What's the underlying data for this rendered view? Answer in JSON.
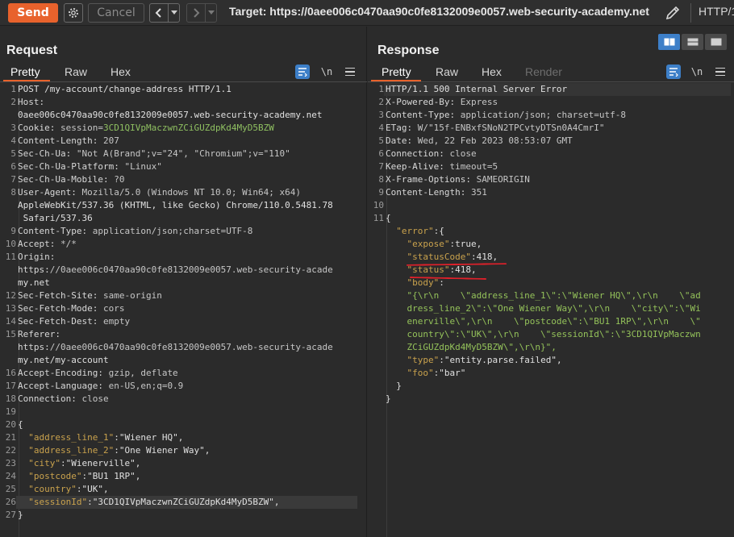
{
  "toolbar": {
    "send_label": "Send",
    "cancel_label": "Cancel",
    "target": "Target: https://0aee006c0470aa90c0fe8132009e0057.web-security-academy.net",
    "http_version": "HTTP/1"
  },
  "request": {
    "title": "Request",
    "tabs": [
      "Pretty",
      "Raw",
      "Hex"
    ],
    "active_tab": "Pretty",
    "lines": [
      {
        "n": "1",
        "text": "POST /my-account/change-address HTTP/1.1"
      },
      {
        "n": "2",
        "text": "Host:"
      },
      {
        "n": "",
        "text": "0aee006c0470aa90c0fe8132009e0057.web-security-academy.net"
      },
      {
        "n": "3",
        "text": "Cookie: session=3CD1QIVpMaczwnZCiGUZdpKd4MyD5BZW"
      },
      {
        "n": "4",
        "text": "Content-Length: 207"
      },
      {
        "n": "5",
        "text": "Sec-Ch-Ua: \"Not A(Brand\";v=\"24\", \"Chromium\";v=\"110\""
      },
      {
        "n": "6",
        "text": "Sec-Ch-Ua-Platform: \"Linux\""
      },
      {
        "n": "7",
        "text": "Sec-Ch-Ua-Mobile: ?0"
      },
      {
        "n": "8",
        "text": "User-Agent: Mozilla/5.0 (Windows NT 10.0; Win64; x64)"
      },
      {
        "n": "",
        "text": "AppleWebKit/537.36 (KHTML, like Gecko) Chrome/110.0.5481.78"
      },
      {
        "n": "",
        "text": " Safari/537.36"
      },
      {
        "n": "9",
        "text": "Content-Type: application/json;charset=UTF-8"
      },
      {
        "n": "10",
        "text": "Accept: */*"
      },
      {
        "n": "11",
        "text": "Origin:"
      },
      {
        "n": "",
        "text": "https://0aee006c0470aa90c0fe8132009e0057.web-security-acade"
      },
      {
        "n": "",
        "text": "my.net"
      },
      {
        "n": "12",
        "text": "Sec-Fetch-Site: same-origin"
      },
      {
        "n": "13",
        "text": "Sec-Fetch-Mode: cors"
      },
      {
        "n": "14",
        "text": "Sec-Fetch-Dest: empty"
      },
      {
        "n": "15",
        "text": "Referer:"
      },
      {
        "n": "",
        "text": "https://0aee006c0470aa90c0fe8132009e0057.web-security-acade"
      },
      {
        "n": "",
        "text": "my.net/my-account"
      },
      {
        "n": "16",
        "text": "Accept-Encoding: gzip, deflate"
      },
      {
        "n": "17",
        "text": "Accept-Language: en-US,en;q=0.9"
      },
      {
        "n": "18",
        "text": "Connection: close"
      },
      {
        "n": "19",
        "text": ""
      },
      {
        "n": "20",
        "text": "{"
      },
      {
        "n": "21",
        "text": "  \"address_line_1\":\"Wiener HQ\","
      },
      {
        "n": "22",
        "text": "  \"address_line_2\":\"One Wiener Way\","
      },
      {
        "n": "23",
        "text": "  \"city\":\"Wienerville\","
      },
      {
        "n": "24",
        "text": "  \"postcode\":\"BU1 1RP\","
      },
      {
        "n": "25",
        "text": "  \"country\":\"UK\","
      },
      {
        "n": "26",
        "text": "  \"sessionId\":\"3CD1QIVpMaczwnZCiGUZdpKd4MyD5BZW\","
      },
      {
        "n": "27",
        "text": "}"
      }
    ]
  },
  "response": {
    "title": "Response",
    "tabs": [
      "Pretty",
      "Raw",
      "Hex",
      "Render"
    ],
    "active_tab": "Pretty",
    "lines": [
      {
        "n": "1",
        "text": "HTTP/1.1 500 Internal Server Error"
      },
      {
        "n": "2",
        "text": "X-Powered-By: Express"
      },
      {
        "n": "3",
        "text": "Content-Type: application/json; charset=utf-8"
      },
      {
        "n": "4",
        "text": "ETag: W/\"15f-ENBxfSNoN2TPCvtyDTSn0A4CmrI\""
      },
      {
        "n": "5",
        "text": "Date: Wed, 22 Feb 2023 08:53:07 GMT"
      },
      {
        "n": "6",
        "text": "Connection: close"
      },
      {
        "n": "7",
        "text": "Keep-Alive: timeout=5"
      },
      {
        "n": "8",
        "text": "X-Frame-Options: SAMEORIGIN"
      },
      {
        "n": "9",
        "text": "Content-Length: 351"
      },
      {
        "n": "10",
        "text": ""
      },
      {
        "n": "11",
        "text": "{"
      },
      {
        "n": "",
        "text": "  \"error\":{"
      },
      {
        "n": "",
        "text": "    \"expose\":true,"
      },
      {
        "n": "",
        "text": "    \"statusCode\":418,"
      },
      {
        "n": "",
        "text": "    \"status\":418,"
      },
      {
        "n": "",
        "text": "    \"body\":"
      },
      {
        "n": "",
        "text": "    \"{\\r\\n    \\\"address_line_1\\\":\\\"Wiener HQ\\\",\\r\\n    \\\"ad"
      },
      {
        "n": "",
        "text": "    dress_line_2\\\":\\\"One Wiener Way\\\",\\r\\n    \\\"city\\\":\\\"Wi"
      },
      {
        "n": "",
        "text": "    enerville\\\",\\r\\n    \\\"postcode\\\":\\\"BU1 1RP\\\",\\r\\n    \\\""
      },
      {
        "n": "",
        "text": "    country\\\":\\\"UK\\\",\\r\\n    \\\"sessionId\\\":\\\"3CD1QIVpMaczwn"
      },
      {
        "n": "",
        "text": "    ZCiGUZdpKd4MyD5BZW\\\",\\r\\n}\","
      },
      {
        "n": "",
        "text": "    \"type\":\"entity.parse.failed\","
      },
      {
        "n": "",
        "text": "    \"foo\":\"bar\""
      },
      {
        "n": "",
        "text": "  }"
      },
      {
        "n": "",
        "text": "}"
      }
    ]
  },
  "colors": {
    "send": "#e8622c",
    "accent": "#e8622c",
    "json_key": "#c9a24d",
    "json_string": "#94c25a",
    "json_number": "#6aa6e0",
    "annotation": "#e0202a"
  },
  "icons": [
    "gear-icon",
    "chevron-left-icon",
    "chevron-right-icon",
    "chevron-down-icon",
    "pencil-icon",
    "pretty-format-icon",
    "newline-icon",
    "menu-icon",
    "layout-icon"
  ]
}
